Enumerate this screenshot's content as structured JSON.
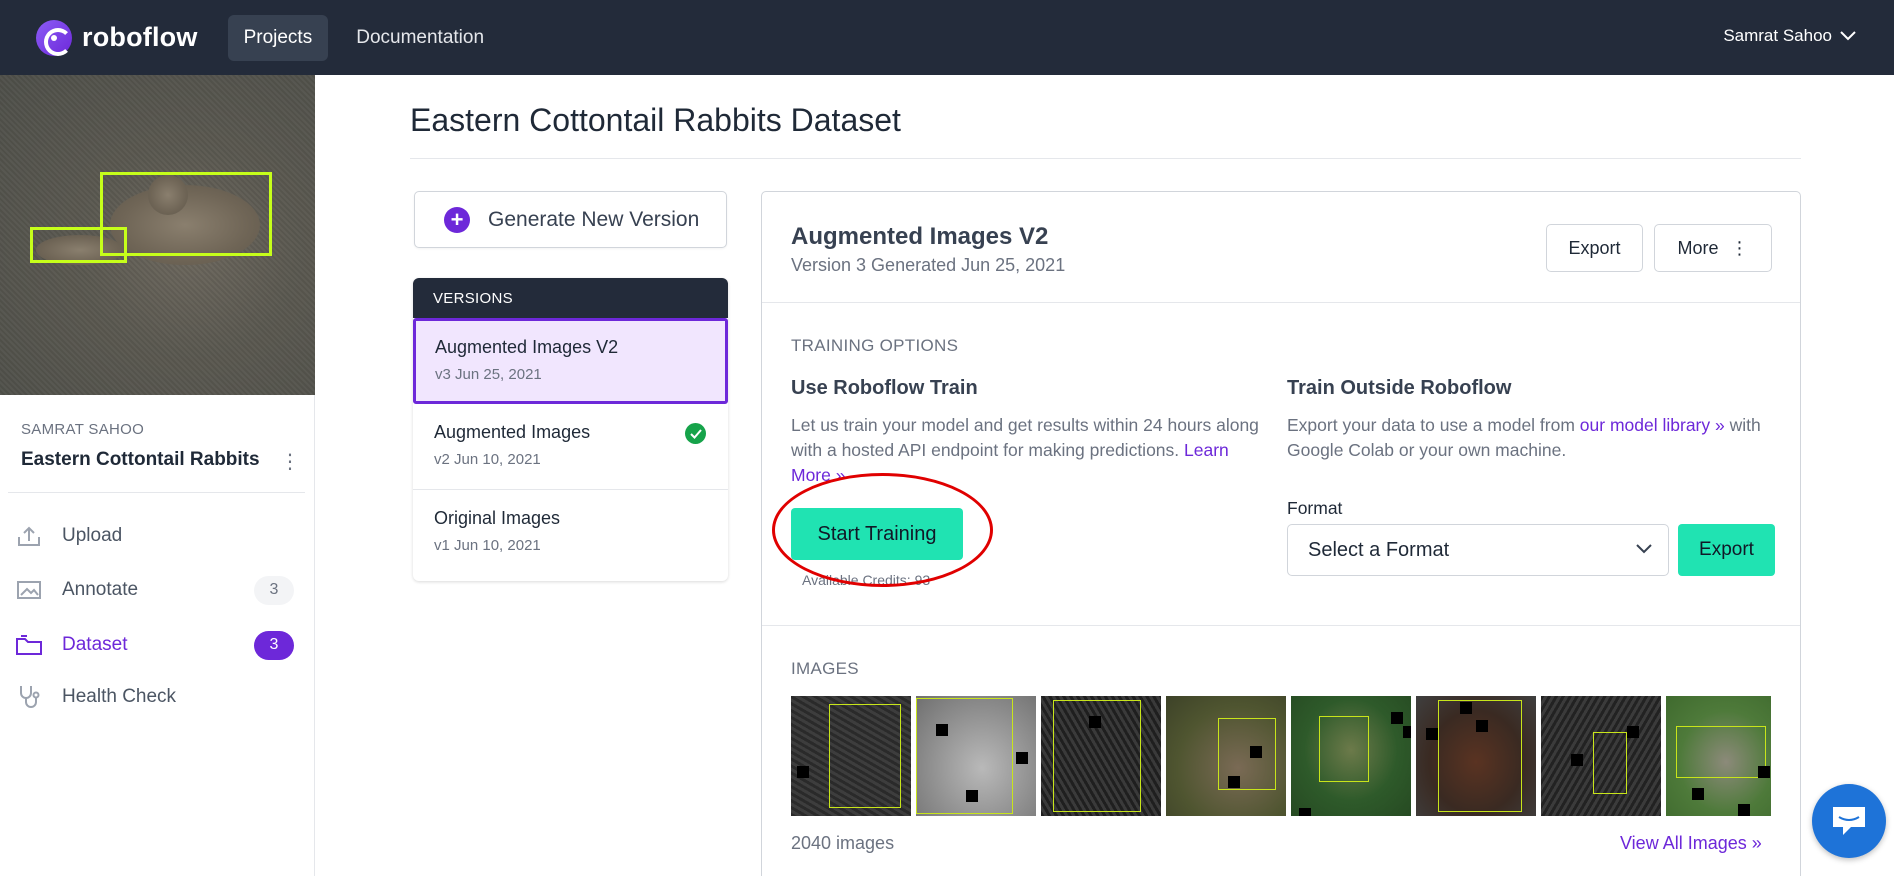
{
  "nav": {
    "brand": "roboflow",
    "projects": "Projects",
    "documentation": "Documentation",
    "user": "Samrat Sahoo"
  },
  "sidebar": {
    "owner": "SAMRAT SAHOO",
    "project_name": "Eastern Cottontail Rabbits",
    "items": [
      {
        "label": "Upload",
        "count": null,
        "icon": "upload-icon"
      },
      {
        "label": "Annotate",
        "count": "3",
        "icon": "annotate-icon"
      },
      {
        "label": "Dataset",
        "count": "3",
        "icon": "dataset-folder-icon",
        "active": true
      },
      {
        "label": "Health Check",
        "count": null,
        "icon": "stethoscope-icon"
      }
    ]
  },
  "page": {
    "title": "Eastern Cottontail Rabbits Dataset"
  },
  "generate": {
    "label": "Generate New Version"
  },
  "versions": {
    "header": "VERSIONS",
    "items": [
      {
        "name": "Augmented Images V2",
        "sub": "v3 Jun 25, 2021",
        "selected": true
      },
      {
        "name": "Augmented Images",
        "sub": "v2 Jun 10, 2021",
        "checked": true
      },
      {
        "name": "Original Images",
        "sub": "v1 Jun 10, 2021"
      }
    ]
  },
  "version_card": {
    "title": "Augmented Images V2",
    "subtitle": "Version 3 Generated Jun 25, 2021",
    "export_label": "Export",
    "more_label": "More"
  },
  "training": {
    "section_label": "TRAINING OPTIONS",
    "roboflow_title": "Use Roboflow Train",
    "roboflow_desc": "Let us train your model and get results within 24 hours along with a hosted API endpoint for making predictions.",
    "learn_more": "Learn More »",
    "start_label": "Start Training",
    "credits": "Available Credits: 93",
    "outside_title": "Train Outside Roboflow",
    "outside_desc_1": "Export your data to use a model from ",
    "outside_link": "our model library »",
    "outside_desc_2": " with Google Colab or your own machine.",
    "format_label": "Format",
    "format_selected": "Select a Format",
    "export_label": "Export"
  },
  "images": {
    "section_label": "IMAGES",
    "count": "2040 images",
    "view_all": "View All Images »"
  },
  "colors": {
    "accent": "#6d28d9",
    "primary_button": "#20e3b2",
    "nav_bg": "#232b3a",
    "annotation_circle": "#e00000"
  }
}
